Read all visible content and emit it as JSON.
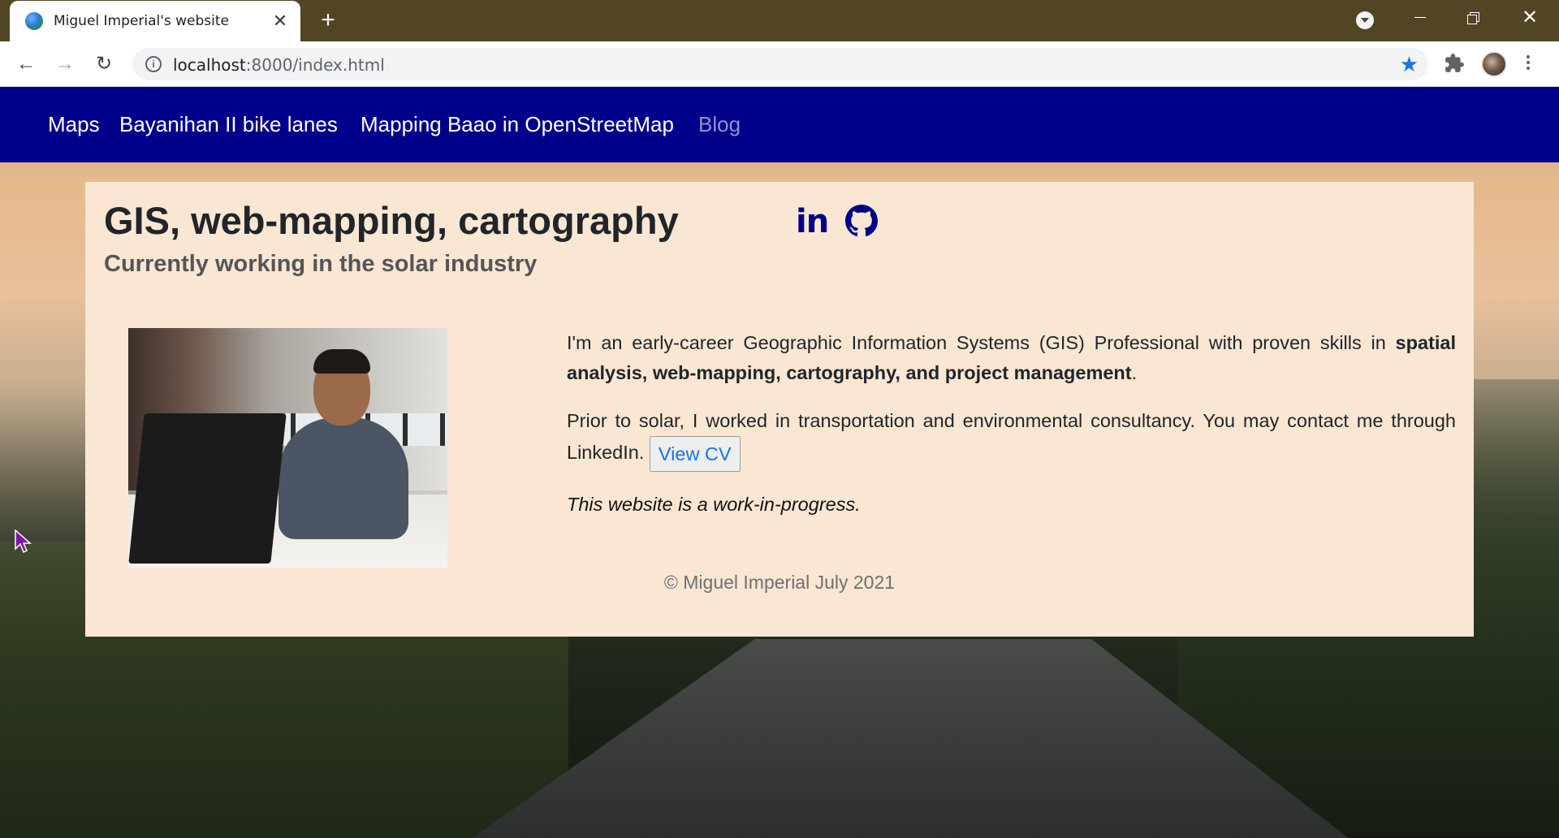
{
  "browser": {
    "tab_title": "Miguel Imperial's website",
    "tab_close": "✕",
    "new_tab": "+",
    "url_host": "localhost",
    "url_rest": ":8000/index.html",
    "window_close": "✕"
  },
  "navbar": {
    "links": [
      "Maps",
      "Bayanihan II bike lanes",
      "Mapping Baao in OpenStreetMap",
      "Blog"
    ],
    "background": "#00008b"
  },
  "header": {
    "title": "GIS, web-mapping, cartography",
    "subtitle": "Currently working in the solar industry",
    "linkedin_text": "in"
  },
  "bio": {
    "p1_start": "I'm an early-career Geographic Information Systems (GIS) Professional with proven skills in ",
    "p1_bold": "spatial analysis, web-mapping, cartography, and project management",
    "p1_end": ".",
    "p2": "Prior to solar, I worked in transportation and environmental consultancy. You may contact me through LinkedIn.",
    "cv_button": "View CV",
    "p3": "This website is a work-in-progress."
  },
  "footer": {
    "copyright": "© Miguel Imperial July 2021"
  },
  "colors": {
    "card": "#fae7d3",
    "accent": "#00008b",
    "link": "#1a73e8"
  }
}
